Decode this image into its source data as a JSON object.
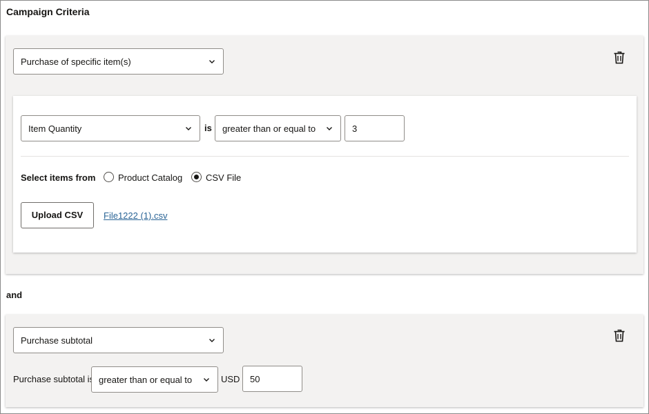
{
  "page": {
    "title": "Campaign Criteria",
    "connector": "and"
  },
  "criterion1": {
    "type_select": "Purchase of specific item(s)",
    "rule": {
      "field_select": "Item Quantity",
      "is_label": "is",
      "operator_select": "greater than or equal to",
      "value": "3"
    },
    "select_items_label": "Select items from",
    "radio_options": [
      {
        "label": "Product Catalog",
        "checked": false
      },
      {
        "label": "CSV File",
        "checked": true
      }
    ],
    "upload_button": "Upload CSV",
    "uploaded_file": "File1222 (1).csv",
    "delete_icon": "trash-icon"
  },
  "criterion2": {
    "type_select": "Purchase subtotal",
    "prefix_label": "Purchase subtotal is",
    "operator_select": "greater than or equal to",
    "currency": "USD",
    "value": "50",
    "delete_icon": "trash-icon"
  },
  "colors": {
    "card_bg": "#f3f2f1",
    "link": "#2a6496",
    "text": "#161513",
    "border": "#8f8c88"
  }
}
